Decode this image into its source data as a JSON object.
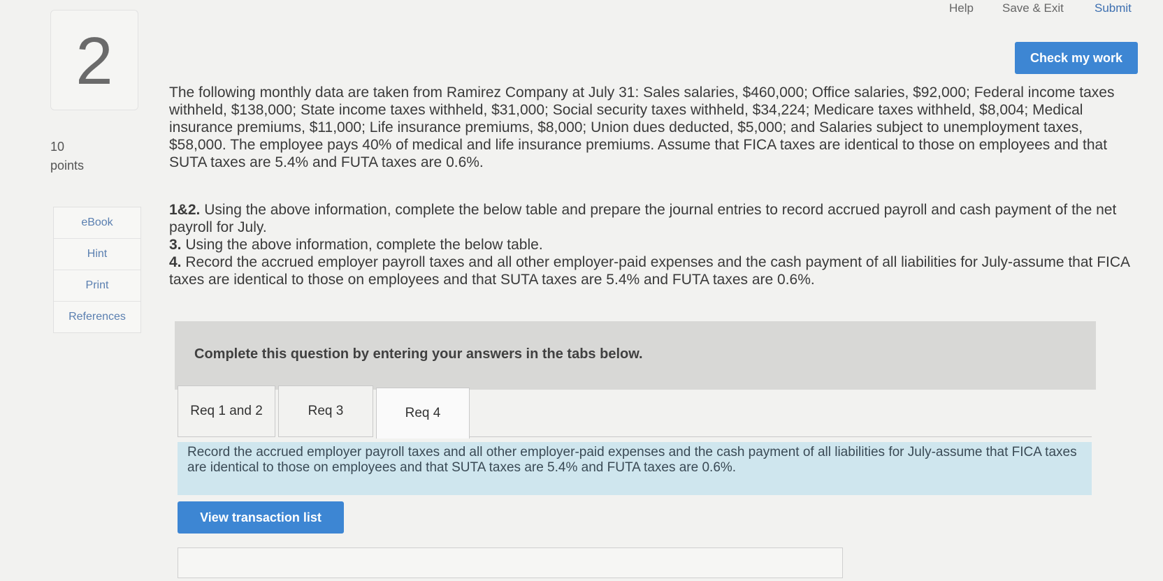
{
  "topnav": {
    "help": "Help",
    "save_exit": "Save & Exit",
    "submit": "Submit"
  },
  "question": {
    "number": "2",
    "points_value": "10",
    "points_label": "points"
  },
  "sidebar": {
    "items": [
      {
        "label": "eBook"
      },
      {
        "label": "Hint"
      },
      {
        "label": "Print"
      },
      {
        "label": "References"
      }
    ]
  },
  "check_button": "Check my work",
  "problem_text": "The following monthly data are taken from Ramirez Company at July 31: Sales salaries, $460,000; Office salaries, $92,000; Federal income taxes withheld, $138,000; State income taxes withheld, $31,000; Social security taxes withheld, $34,224; Medicare taxes withheld, $8,004; Medical insurance premiums, $11,000; Life insurance premiums, $8,000; Union dues deducted, $5,000; and Salaries subject to unemployment taxes, $58,000. The employee pays 40% of medical and life insurance premiums. Assume that FICA taxes are identical to those on employees and that SUTA taxes are 5.4% and FUTA taxes are 0.6%.",
  "requirements": [
    {
      "num": "1&2.",
      "text": "Using the above information, complete the below table and prepare the journal entries to record accrued payroll and cash payment of the net payroll for July."
    },
    {
      "num": "3.",
      "text": "Using the above information, complete the below table."
    },
    {
      "num": "4.",
      "text": "Record the accrued employer payroll taxes and all other employer-paid expenses and the cash payment of all liabilities for July-assume that FICA taxes are identical to those on employees and that SUTA taxes are 5.4% and FUTA taxes are 0.6%."
    }
  ],
  "instruction": "Complete this question by entering your answers in the tabs below.",
  "tabs": [
    {
      "label": "Req 1 and 2"
    },
    {
      "label": "Req 3"
    },
    {
      "label": "Req 4"
    }
  ],
  "active_tab": "Req 4",
  "req_description": "Record the accrued employer payroll taxes and all other employer-paid expenses and the cash payment of all liabilities for July-assume that FICA taxes are identical to those on employees and that SUTA taxes are 5.4% and FUTA taxes are 0.6%.",
  "view_transaction_button": "View transaction list"
}
